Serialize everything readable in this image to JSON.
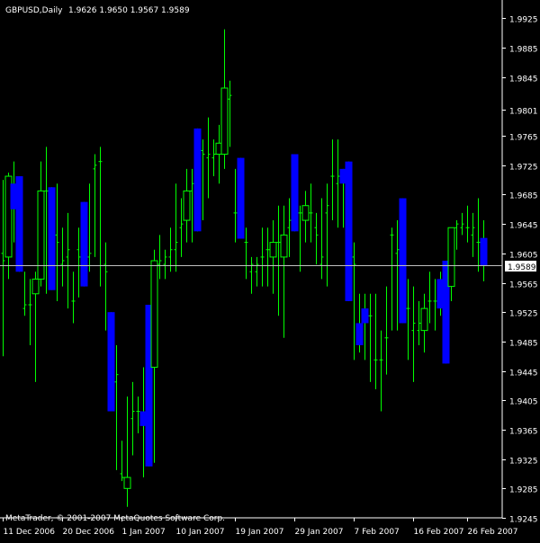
{
  "header": {
    "symbol_label": "GBPUSD,Daily",
    "ohlc_label": "1.9626 1.9650 1.9567 1.9589"
  },
  "footer": {
    "copyright": "MetaTrader, © 2001-2007 MetaQuotes Software Corp."
  },
  "colors": {
    "background": "#000000",
    "axis": "#ffffff",
    "bull_candle": "#00ff00",
    "bear_candle": "#0000ff",
    "price_line": "#c0c0c0",
    "current_price_label_bg": "#ffffff",
    "current_price_label_text": "#000000"
  },
  "chart_data": {
    "type": "candlestick",
    "symbol": "GBPUSD",
    "timeframe": "Daily",
    "current_price": "1.9589",
    "ylim": [
      1.9245,
      1.9945
    ],
    "y_ticks": [
      "1.9925",
      "1.9885",
      "1.9845",
      "1.9801",
      "1.9765",
      "1.9725",
      "1.9685",
      "1.9645",
      "1.9605",
      "1.9565",
      "1.9525",
      "1.9485",
      "1.9445",
      "1.9405",
      "1.9365",
      "1.9325",
      "1.9285",
      "1.9245"
    ],
    "x_ticks": [
      "11 Dec 2006",
      "20 Dec 2006",
      "1 Jan 2007",
      "10 Jan 2007",
      "19 Jan 2007",
      "29 Jan 2007",
      "7 Feb 2007",
      "16 Feb 2007",
      "26 Feb 2007"
    ],
    "candles": [
      {
        "o": 1.9605,
        "h": 1.9705,
        "l": 1.9465,
        "c": 1.9595
      },
      {
        "o": 1.96,
        "h": 1.9715,
        "l": 1.957,
        "c": 1.971
      },
      {
        "o": 1.97,
        "h": 1.973,
        "l": 1.962,
        "c": 1.9665
      },
      {
        "o": 1.971,
        "h": 1.971,
        "l": 1.958,
        "c": 1.958
      },
      {
        "o": 1.953,
        "h": 1.958,
        "l": 1.952,
        "c": 1.9535
      },
      {
        "o": 1.9535,
        "h": 1.957,
        "l": 1.948,
        "c": 1.9535
      },
      {
        "o": 1.955,
        "h": 1.958,
        "l": 1.943,
        "c": 1.957
      },
      {
        "o": 1.957,
        "h": 1.973,
        "l": 1.956,
        "c": 1.969
      },
      {
        "o": 1.969,
        "h": 1.975,
        "l": 1.955,
        "c": 1.969
      },
      {
        "o": 1.9695,
        "h": 1.9695,
        "l": 1.9555,
        "c": 1.9555
      },
      {
        "o": 1.963,
        "h": 1.97,
        "l": 1.954,
        "c": 1.962
      },
      {
        "o": 1.959,
        "h": 1.964,
        "l": 1.956,
        "c": 1.9595
      },
      {
        "o": 1.96,
        "h": 1.966,
        "l": 1.953,
        "c": 1.961
      },
      {
        "o": 1.954,
        "h": 1.958,
        "l": 1.951,
        "c": 1.954
      },
      {
        "o": 1.961,
        "h": 1.964,
        "l": 1.9545,
        "c": 1.96
      },
      {
        "o": 1.9675,
        "h": 1.9675,
        "l": 1.956,
        "c": 1.956
      },
      {
        "o": 1.96,
        "h": 1.97,
        "l": 1.958,
        "c": 1.9605
      },
      {
        "o": 1.972,
        "h": 1.974,
        "l": 1.96,
        "c": 1.9725
      },
      {
        "o": 1.973,
        "h": 1.975,
        "l": 1.956,
        "c": 1.973
      },
      {
        "o": 1.959,
        "h": 1.962,
        "l": 1.95,
        "c": 1.958
      },
      {
        "o": 1.9525,
        "h": 1.9525,
        "l": 1.939,
        "c": 1.939
      },
      {
        "o": 1.943,
        "h": 1.948,
        "l": 1.931,
        "c": 1.944
      },
      {
        "o": 1.9305,
        "h": 1.935,
        "l": 1.9295,
        "c": 1.93
      },
      {
        "o": 1.9285,
        "h": 1.941,
        "l": 1.926,
        "c": 1.93
      },
      {
        "o": 1.938,
        "h": 1.943,
        "l": 1.933,
        "c": 1.939
      },
      {
        "o": 1.939,
        "h": 1.941,
        "l": 1.936,
        "c": 1.939
      },
      {
        "o": 1.939,
        "h": 1.945,
        "l": 1.93,
        "c": 1.937
      },
      {
        "o": 1.9535,
        "h": 1.9535,
        "l": 1.9315,
        "c": 1.9315
      },
      {
        "o": 1.945,
        "h": 1.961,
        "l": 1.932,
        "c": 1.9595
      },
      {
        "o": 1.959,
        "h": 1.963,
        "l": 1.957,
        "c": 1.9595
      },
      {
        "o": 1.959,
        "h": 1.961,
        "l": 1.957,
        "c": 1.96
      },
      {
        "o": 1.96,
        "h": 1.964,
        "l": 1.958,
        "c": 1.961
      },
      {
        "o": 1.961,
        "h": 1.97,
        "l": 1.958,
        "c": 1.962
      },
      {
        "o": 1.964,
        "h": 1.968,
        "l": 1.96,
        "c": 1.9645
      },
      {
        "o": 1.965,
        "h": 1.972,
        "l": 1.962,
        "c": 1.969
      },
      {
        "o": 1.969,
        "h": 1.972,
        "l": 1.962,
        "c": 1.97
      },
      {
        "o": 1.9775,
        "h": 1.9775,
        "l": 1.9635,
        "c": 1.9635
      },
      {
        "o": 1.9745,
        "h": 1.976,
        "l": 1.965,
        "c": 1.974
      },
      {
        "o": 1.9735,
        "h": 1.979,
        "l": 1.968,
        "c": 1.974
      },
      {
        "o": 1.9735,
        "h": 1.976,
        "l": 1.971,
        "c": 1.974
      },
      {
        "o": 1.974,
        "h": 1.978,
        "l": 1.97,
        "c": 1.9755
      },
      {
        "o": 1.974,
        "h": 1.991,
        "l": 1.972,
        "c": 1.983
      },
      {
        "o": 1.9815,
        "h": 1.984,
        "l": 1.975,
        "c": 1.982
      },
      {
        "o": 1.966,
        "h": 1.972,
        "l": 1.962,
        "c": 1.966
      },
      {
        "o": 1.9735,
        "h": 1.9735,
        "l": 1.9625,
        "c": 1.9625
      },
      {
        "o": 1.962,
        "h": 1.964,
        "l": 1.957,
        "c": 1.962
      },
      {
        "o": 1.958,
        "h": 1.96,
        "l": 1.955,
        "c": 1.959
      },
      {
        "o": 1.958,
        "h": 1.96,
        "l": 1.956,
        "c": 1.959
      },
      {
        "o": 1.96,
        "h": 1.964,
        "l": 1.956,
        "c": 1.96
      },
      {
        "o": 1.961,
        "h": 1.964,
        "l": 1.956,
        "c": 1.961
      },
      {
        "o": 1.96,
        "h": 1.965,
        "l": 1.955,
        "c": 1.962
      },
      {
        "o": 1.962,
        "h": 1.967,
        "l": 1.952,
        "c": 1.962
      },
      {
        "o": 1.96,
        "h": 1.967,
        "l": 1.949,
        "c": 1.963
      },
      {
        "o": 1.964,
        "h": 1.968,
        "l": 1.96,
        "c": 1.965
      },
      {
        "o": 1.974,
        "h": 1.974,
        "l": 1.9635,
        "c": 1.9635
      },
      {
        "o": 1.966,
        "h": 1.967,
        "l": 1.958,
        "c": 1.966
      },
      {
        "o": 1.965,
        "h": 1.969,
        "l": 1.962,
        "c": 1.967
      },
      {
        "o": 1.966,
        "h": 1.97,
        "l": 1.962,
        "c": 1.966
      },
      {
        "o": 1.964,
        "h": 1.966,
        "l": 1.959,
        "c": 1.963
      },
      {
        "o": 1.959,
        "h": 1.968,
        "l": 1.957,
        "c": 1.96
      },
      {
        "o": 1.966,
        "h": 1.97,
        "l": 1.956,
        "c": 1.967
      },
      {
        "o": 1.971,
        "h": 1.976,
        "l": 1.965,
        "c": 1.971
      },
      {
        "o": 1.97,
        "h": 1.976,
        "l": 1.964,
        "c": 1.971
      },
      {
        "o": 1.972,
        "h": 1.972,
        "l": 1.964,
        "c": 1.97
      },
      {
        "o": 1.973,
        "h": 1.973,
        "l": 1.954,
        "c": 1.954
      },
      {
        "o": 1.96,
        "h": 1.962,
        "l": 1.946,
        "c": 1.959
      },
      {
        "o": 1.951,
        "h": 1.955,
        "l": 1.947,
        "c": 1.948
      },
      {
        "o": 1.953,
        "h": 1.955,
        "l": 1.946,
        "c": 1.951
      },
      {
        "o": 1.952,
        "h": 1.955,
        "l": 1.943,
        "c": 1.952
      },
      {
        "o": 1.946,
        "h": 1.955,
        "l": 1.942,
        "c": 1.946
      },
      {
        "o": 1.946,
        "h": 1.95,
        "l": 1.939,
        "c": 1.946
      },
      {
        "o": 1.949,
        "h": 1.956,
        "l": 1.944,
        "c": 1.949
      },
      {
        "o": 1.963,
        "h": 1.964,
        "l": 1.95,
        "c": 1.963
      },
      {
        "o": 1.9605,
        "h": 1.965,
        "l": 1.95,
        "c": 1.961
      },
      {
        "o": 1.968,
        "h": 1.968,
        "l": 1.951,
        "c": 1.951
      },
      {
        "o": 1.953,
        "h": 1.957,
        "l": 1.946,
        "c": 1.953
      },
      {
        "o": 1.95,
        "h": 1.956,
        "l": 1.943,
        "c": 1.951
      },
      {
        "o": 1.95,
        "h": 1.954,
        "l": 1.948,
        "c": 1.951
      },
      {
        "o": 1.95,
        "h": 1.955,
        "l": 1.947,
        "c": 1.953
      },
      {
        "o": 1.954,
        "h": 1.958,
        "l": 1.951,
        "c": 1.954
      },
      {
        "o": 1.954,
        "h": 1.957,
        "l": 1.95,
        "c": 1.954
      },
      {
        "o": 1.957,
        "h": 1.958,
        "l": 1.952,
        "c": 1.953
      },
      {
        "o": 1.9595,
        "h": 1.9595,
        "l": 1.9455,
        "c": 1.9455
      },
      {
        "o": 1.956,
        "h": 1.964,
        "l": 1.954,
        "c": 1.964
      },
      {
        "o": 1.964,
        "h": 1.965,
        "l": 1.961,
        "c": 1.9645
      },
      {
        "o": 1.964,
        "h": 1.966,
        "l": 1.963,
        "c": 1.9645
      },
      {
        "o": 1.964,
        "h": 1.967,
        "l": 1.962,
        "c": 1.964
      },
      {
        "o": 1.963,
        "h": 1.966,
        "l": 1.96,
        "c": 1.964
      },
      {
        "o": 1.962,
        "h": 1.968,
        "l": 1.958,
        "c": 1.962
      },
      {
        "o": 1.9626,
        "h": 1.965,
        "l": 1.9567,
        "c": 1.9589
      }
    ]
  }
}
